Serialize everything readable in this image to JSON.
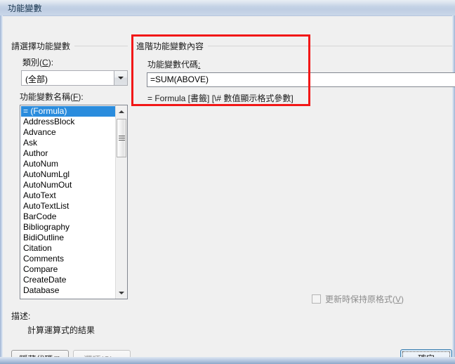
{
  "window": {
    "title": "功能變數"
  },
  "groups": {
    "select_field": "請選擇功能變數",
    "advanced_field_properties": "進階功能變數內容"
  },
  "category": {
    "label": "類別",
    "mnemonic": "C",
    "suffix": ":",
    "value": "(全部)"
  },
  "field_names": {
    "label": "功能變數名稱",
    "mnemonic": "F",
    "suffix": ":",
    "selected": "= (Formula)",
    "items": [
      "= (Formula)",
      "AddressBlock",
      "Advance",
      "Ask",
      "Author",
      "AutoNum",
      "AutoNumLgl",
      "AutoNumOut",
      "AutoText",
      "AutoTextList",
      "BarCode",
      "Bibliography",
      "BidiOutline",
      "Citation",
      "Comments",
      "Compare",
      "CreateDate",
      "Database"
    ]
  },
  "field_code": {
    "label": "功能變數代碼",
    "suffix": ":",
    "value": "=SUM(ABOVE)",
    "syntax_hint": "= Formula [書籤] [\\# 數值顯示格式參數]"
  },
  "preserve_formatting": {
    "label": "更新時保持原格式",
    "mnemonic": "V",
    "checked": false
  },
  "description": {
    "label": "描述:",
    "value": "計算運算式的結果"
  },
  "buttons": {
    "hide_codes": "隱藏代碼(I)",
    "options": "選項(O)...",
    "ok": "確定"
  },
  "annotation": {
    "color": "#f21717"
  }
}
